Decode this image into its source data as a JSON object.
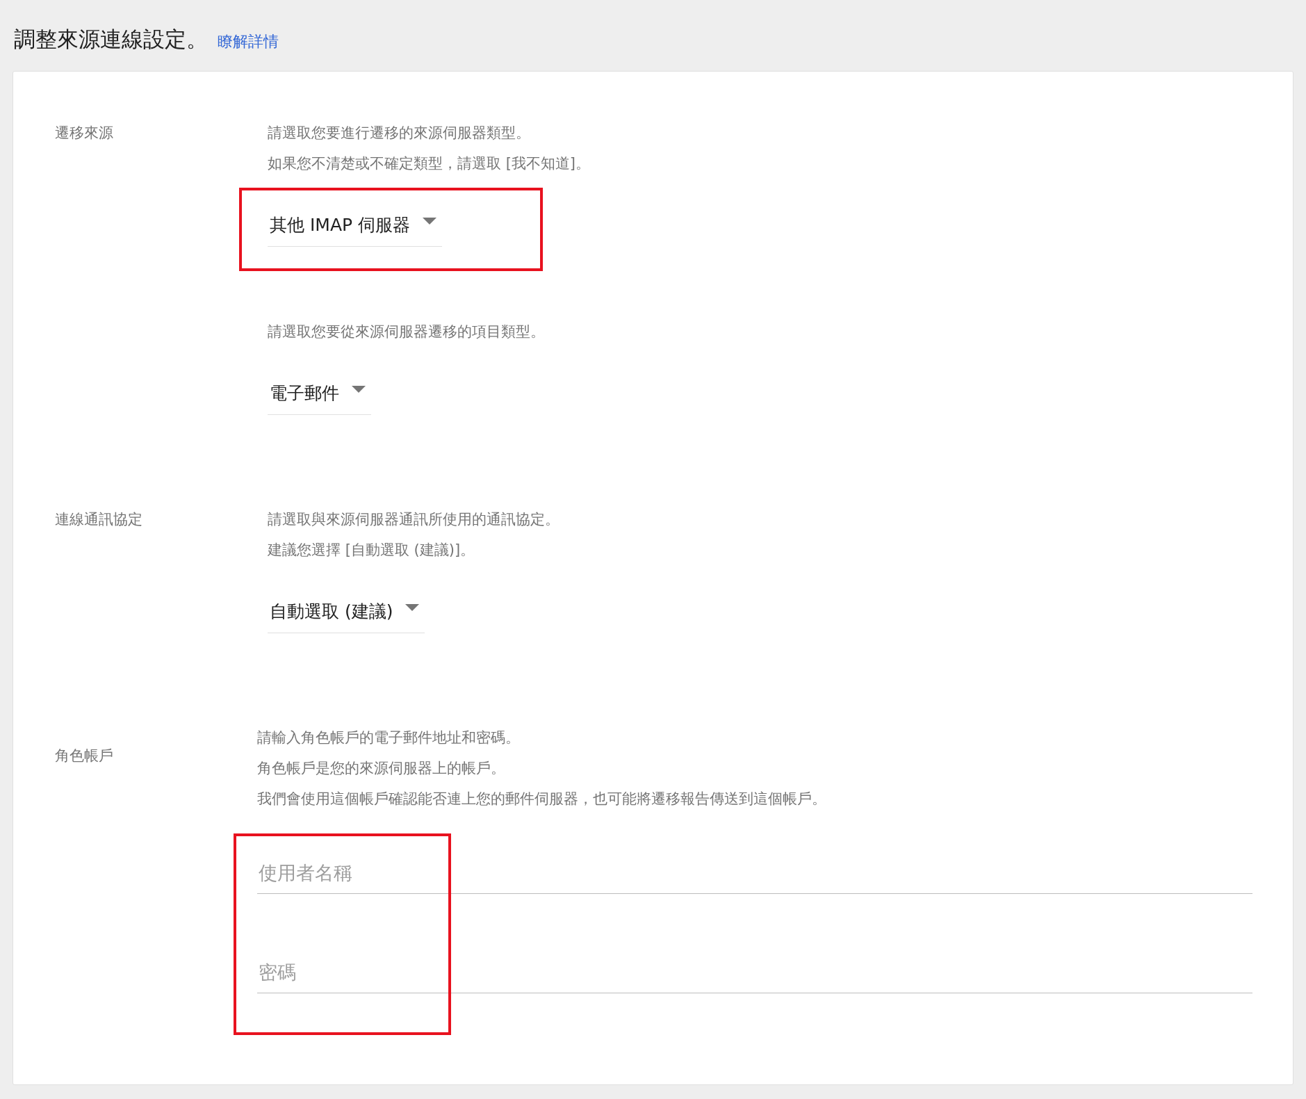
{
  "header": {
    "title": "調整來源連線設定。",
    "link": "瞭解詳情"
  },
  "sections": [
    {
      "label": "遷移來源",
      "kind": "selects",
      "items": [
        {
          "description": [
            "請選取您要進行遷移的來源伺服器類型。",
            "如果您不清楚或不確定類型，請選取 [我不知道]。"
          ],
          "value": "其他 IMAP 伺服器",
          "highlighted": true
        },
        {
          "description": [
            "請選取您要從來源伺服器遷移的項目類型。"
          ],
          "value": "電子郵件",
          "highlighted": false
        }
      ]
    },
    {
      "label": "連線通訊協定",
      "kind": "selects",
      "items": [
        {
          "description": [
            "請選取與來源伺服器通訊所使用的通訊協定。",
            "建議您選擇 [自動選取 (建議)]。"
          ],
          "value": "自動選取 (建議)",
          "highlighted": false
        }
      ]
    },
    {
      "label": "角色帳戶",
      "kind": "fields",
      "description": [
        "請輸入角色帳戶的電子郵件地址和密碼。",
        "角色帳戶是您的來源伺服器上的帳戶。",
        "我們會使用這個帳戶確認能否連上您的郵件伺服器，也可能將遷移報告傳送到這個帳戶。"
      ],
      "highlighted": true,
      "fields": [
        {
          "placeholder": "使用者名稱"
        },
        {
          "placeholder": "密碼"
        }
      ]
    }
  ]
}
